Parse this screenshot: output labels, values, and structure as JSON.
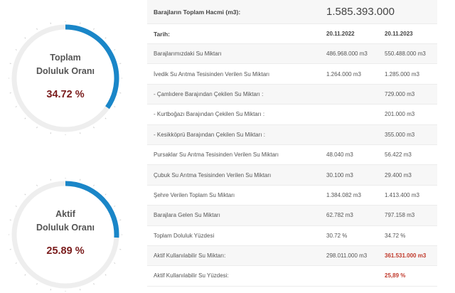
{
  "gauges": [
    {
      "line1": "Toplam",
      "line2": "Doluluk Oranı",
      "value_text": "34.72 %",
      "percent": 34.72,
      "accent": "#1a86c8"
    },
    {
      "line1": "Aktif",
      "line2": "Doluluk Oranı",
      "value_text": "25.89 %",
      "percent": 25.89,
      "accent": "#1a86c8"
    }
  ],
  "table": {
    "total_label": "Barajların Toplam Hacmi (m3):",
    "total_value": "1.585.393.000",
    "date_label": "Tarih:",
    "date1": "20.11.2022",
    "date2": "20.11.2023",
    "rows": [
      {
        "label": "Barajlarımızdaki Su Miktarı",
        "v1": "486.968.000 m3",
        "v2": "550.488.000 m3"
      },
      {
        "label": "İvedik Su Arıtma Tesisinden Verilen Su Miktarı",
        "v1": "1.264.000 m3",
        "v2": "1.285.000 m3"
      },
      {
        "label": "- Çamlıdere Barajından Çekilen Su Miktarı :",
        "v1": "",
        "v2": "729.000 m3"
      },
      {
        "label": "- Kurtboğazı Barajından Çekilen Su Miktarı :",
        "v1": "",
        "v2": "201.000 m3"
      },
      {
        "label": "- Kesikköprü Barajından Çekilen Su Miktarı :",
        "v1": "",
        "v2": "355.000 m3"
      },
      {
        "label": "Pursaklar Su Arıtma Tesisinden Verilen Su Miktarı",
        "v1": "48.040 m3",
        "v2": "56.422 m3"
      },
      {
        "label": "Çubuk Su Arıtma Tesisinden Verilen Su Miktarı",
        "v1": "30.100 m3",
        "v2": "29.400 m3"
      },
      {
        "label": "Şehre Verilen Toplam Su Miktarı",
        "v1": "1.384.082 m3",
        "v2": "1.413.400 m3"
      },
      {
        "label": "Barajlara Gelen Su Miktarı",
        "v1": "62.782 m3",
        "v2": "797.158 m3"
      },
      {
        "label": "Toplam Doluluk Yüzdesi",
        "v1": "30.72 %",
        "v2": "34.72 %"
      },
      {
        "label": "Aktif Kullanılabilir Su Miktarı:",
        "v1": "298.011.000 m3",
        "v2": "361.531.000 m3",
        "v2_highlight": true
      },
      {
        "label": "Aktif Kullanılabilir Su Yüzdesi:",
        "v1": "",
        "v2": "25,89 %",
        "v2_highlight": true
      }
    ]
  }
}
